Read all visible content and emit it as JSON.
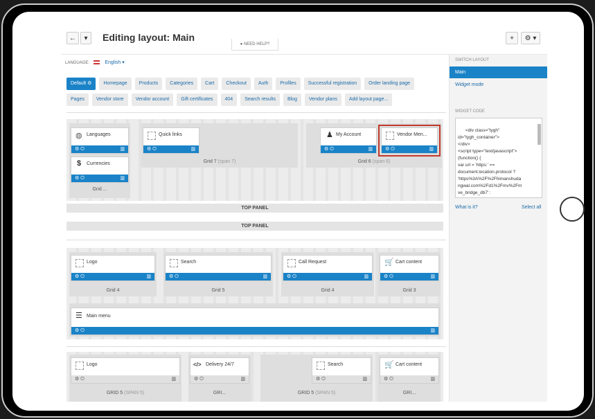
{
  "header": {
    "title": "Editing layout: Main",
    "back_icon": "←",
    "menu_icon": "▾",
    "help": "NEED HELP?",
    "add_icon": "+",
    "gear_icon": "⚙ ▾"
  },
  "language": {
    "label": "LANGUAGE:",
    "value": "English ▾"
  },
  "tabs_row1": [
    "Default ⚙",
    "Homepage",
    "Products",
    "Categories",
    "Cart",
    "Checkout",
    "Auth",
    "Profiles",
    "Successful registration",
    "Order landing page"
  ],
  "tabs_row2": [
    "Pages",
    "Vendor store",
    "Vendor account",
    "Gift certificates",
    "404",
    "Search results",
    "Blog",
    "Vendor plans",
    "Add layout page..."
  ],
  "section1": {
    "blocks": {
      "languages": "Languages",
      "currencies": "Currencies",
      "quick_links": "Quick links",
      "my_account": "My Account",
      "vendor_menu": "Vendor Men..."
    },
    "grid_labels": {
      "g1": "Grid ...",
      "g7": "Grid 7",
      "g7_span": "(span 7)",
      "g6": "Grid 6",
      "g6_span": "(span 6)"
    }
  },
  "panels": {
    "top1": "TOP PANEL",
    "top2": "TOP PANEL"
  },
  "section2": {
    "blocks": {
      "logo": "Logo",
      "search": "Search",
      "call_request": "Call Request",
      "cart_content": "Cart content",
      "main_menu": "Main menu"
    },
    "grid_labels": {
      "g4a": "Grid 4",
      "g5": "Grid 5",
      "g4b": "Grid 4",
      "g3": "Grid 3"
    }
  },
  "section3": {
    "blocks": {
      "logo": "Logo",
      "delivery": "Delivery 24/7",
      "search": "Search",
      "cart_content": "Cart content"
    },
    "grid_labels": {
      "g5a": "GRID 5",
      "g5a_span": "(SPAN 5)",
      "gri1": "GRI...",
      "g5b": "GRID 5",
      "g5b_span": "(SPAN 5)",
      "gri2": "GRI..."
    }
  },
  "sidebar": {
    "switch_label": "SWITCH LAYOUT",
    "items": [
      "Main",
      "Widget mode"
    ],
    "widget_label": "WIDGET CODE",
    "code": "<div class=\"tygh\"\nid=\"tygh_container\">\n</div>\n<script type=\"text/javascript\">\n(function() {\nvar url = 'https:' ==\ndocument.location.protocol ?\n'https%3A%2F%2Fhimanshuda\nngwal.com%2Fd1%2Fmv%2Fm\nve_bridge_db7' :",
    "what_is_it": "What is it?",
    "select_all": "Select all"
  },
  "bar_icons": {
    "settings": "⚙ ⏻",
    "trash": "🗑"
  },
  "colors": {
    "accent": "#1a83c8",
    "highlight": "#c0392b"
  }
}
